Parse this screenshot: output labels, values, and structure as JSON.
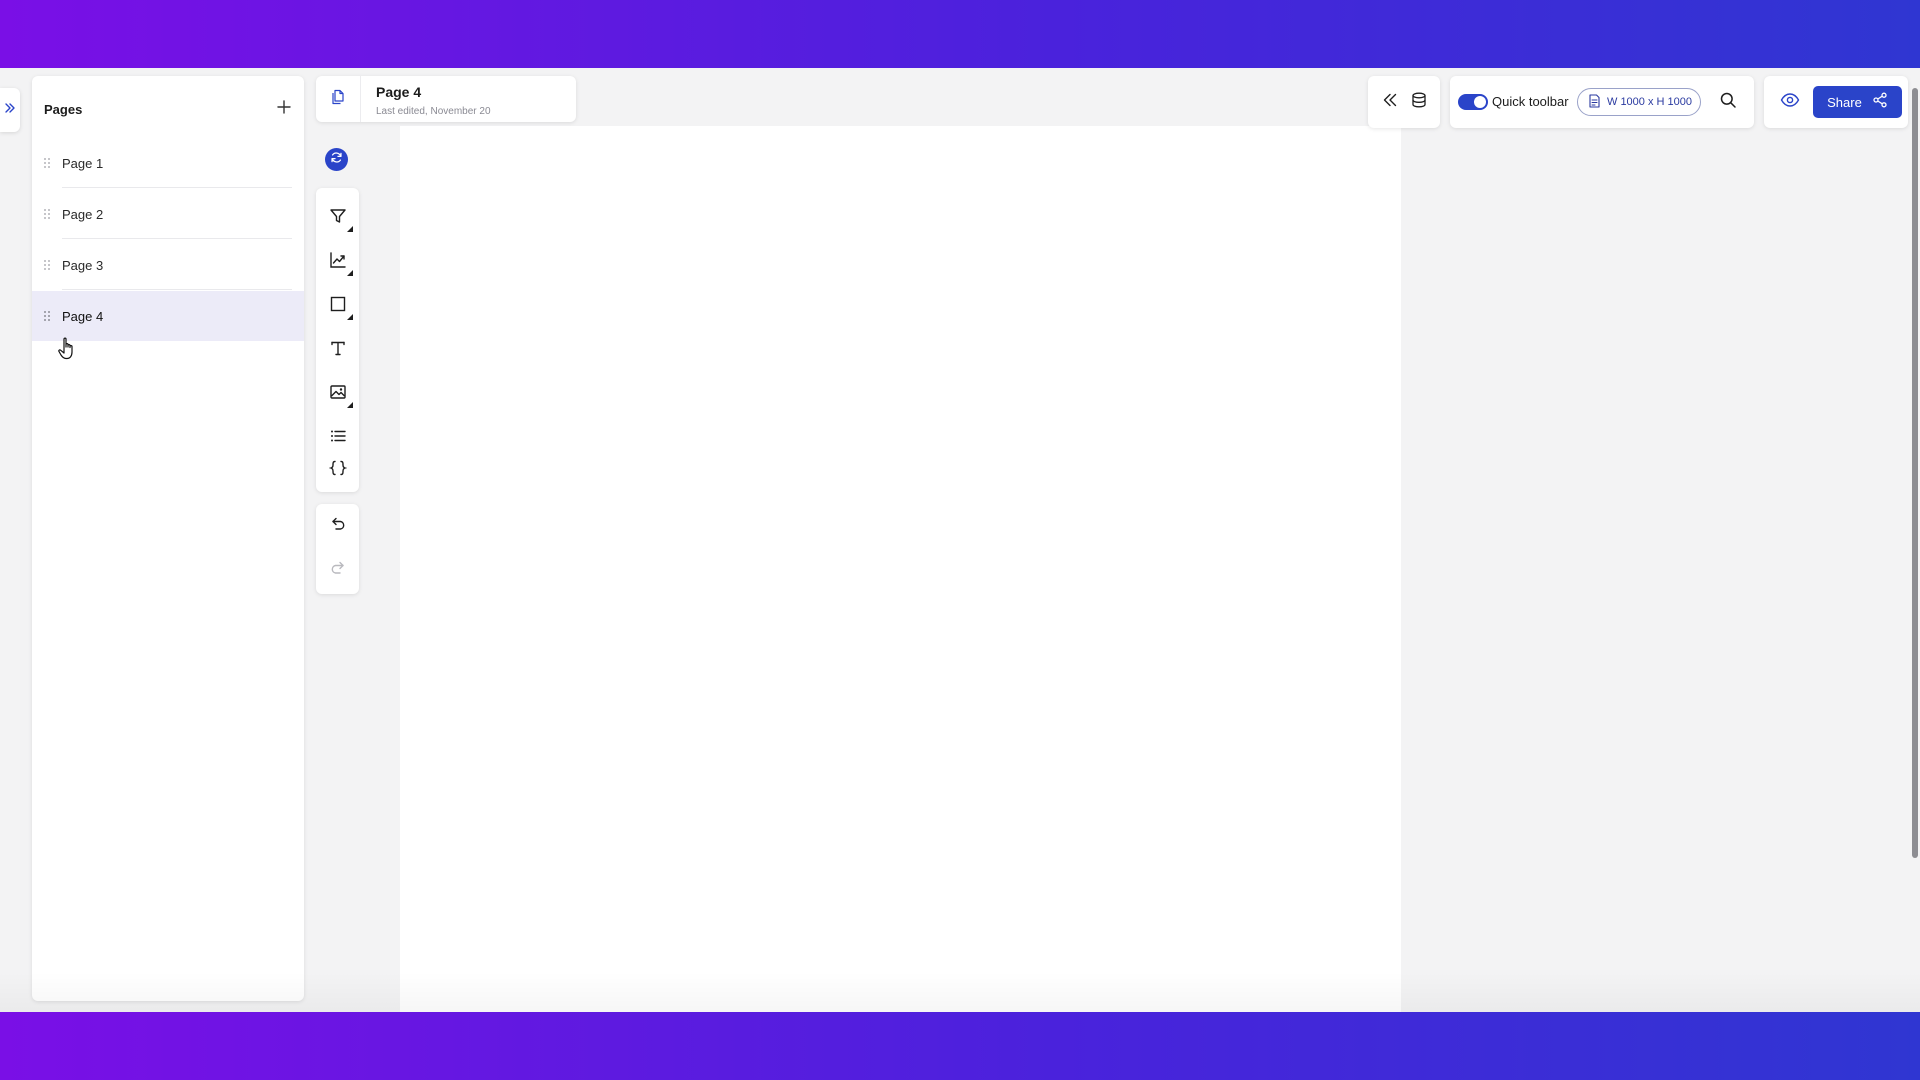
{
  "pages_panel": {
    "title": "Pages",
    "add_icon": "plus-icon",
    "items": [
      {
        "label": "Page 1",
        "active": false
      },
      {
        "label": "Page 2",
        "active": false
      },
      {
        "label": "Page 3",
        "active": false
      },
      {
        "label": "Page 4",
        "active": true
      }
    ]
  },
  "file": {
    "name": "Page 4",
    "meta": "Last edited, November 20",
    "icon": "file-copy-icon"
  },
  "tools": [
    {
      "name": "filter-icon",
      "has_submenu": true
    },
    {
      "name": "chart-icon",
      "has_submenu": true
    },
    {
      "name": "shape-icon",
      "has_submenu": true
    },
    {
      "name": "text-icon",
      "has_submenu": false
    },
    {
      "name": "image-icon",
      "has_submenu": true
    },
    {
      "name": "list-icon",
      "has_submenu": false
    },
    {
      "name": "code-braces-icon",
      "has_submenu": false
    }
  ],
  "history": [
    {
      "name": "undo-icon",
      "enabled": true
    },
    {
      "name": "redo-icon",
      "enabled": false
    }
  ],
  "top_right": {
    "quick_toolbar": {
      "label": "Quick toolbar",
      "enabled": true
    },
    "canvas_size": "W 1000 x H 1000",
    "share_label": "Share"
  },
  "colors": {
    "accent": "#2a44c9",
    "gradient_start": "#7a0fe6",
    "gradient_end": "#2f36d2",
    "active_row": "#ecebf8",
    "workspace": "#f3f3f4"
  }
}
